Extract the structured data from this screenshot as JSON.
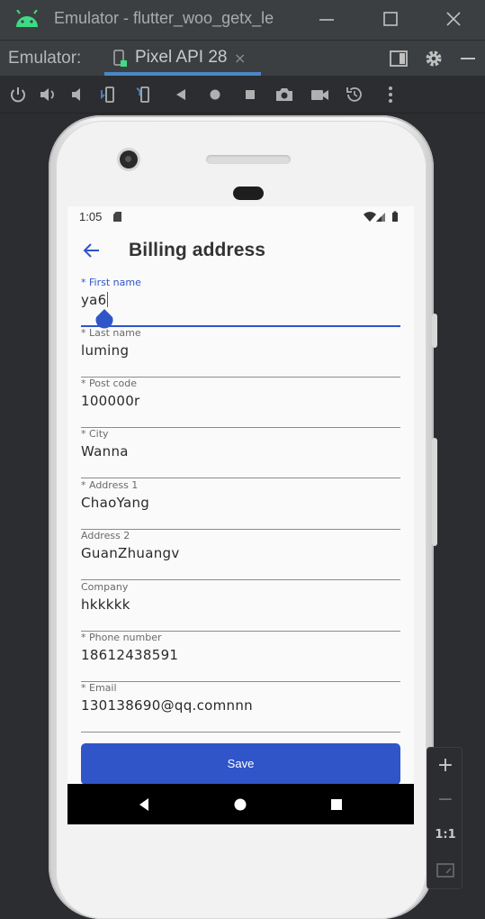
{
  "window": {
    "title": "Emulator - flutter_woo_getx_le"
  },
  "tabbar": {
    "label": "Emulator:",
    "device_tab": "Pixel API 28",
    "close_glyph": "×"
  },
  "toolbar": {
    "icons": [
      "power-icon",
      "volume-up-icon",
      "volume-down-icon",
      "rotate-left-icon",
      "rotate-right-icon",
      "back-icon",
      "home-icon",
      "overview-icon",
      "screenshot-icon",
      "record-icon",
      "snapshot-icon",
      "more-icon"
    ]
  },
  "status": {
    "time": "1:05"
  },
  "app": {
    "title": "Billing address",
    "fields": [
      {
        "label": "* First name",
        "value": "ya6"
      },
      {
        "label": "* Last name",
        "value": "luming"
      },
      {
        "label": "* Post code",
        "value": "100000r"
      },
      {
        "label": "* City",
        "value": "Wanna"
      },
      {
        "label": "* Address 1",
        "value": "ChaoYang"
      },
      {
        "label": "Address 2",
        "value": "GuanZhuangv"
      },
      {
        "label": "Company",
        "value": "hkkkkk"
      },
      {
        "label": "* Phone number",
        "value": "18612438591"
      },
      {
        "label": "* Email",
        "value": "130138690@qq.comnnn"
      }
    ],
    "save_label": "Save"
  },
  "zoom": {
    "plus": "+",
    "minus": "−",
    "one_to_one": "1:1"
  },
  "colors": {
    "accent": "#2f55c9",
    "ide_bg": "#2b2d30",
    "tab_underline": "#4a88c7",
    "android_green": "#3ddc84"
  }
}
